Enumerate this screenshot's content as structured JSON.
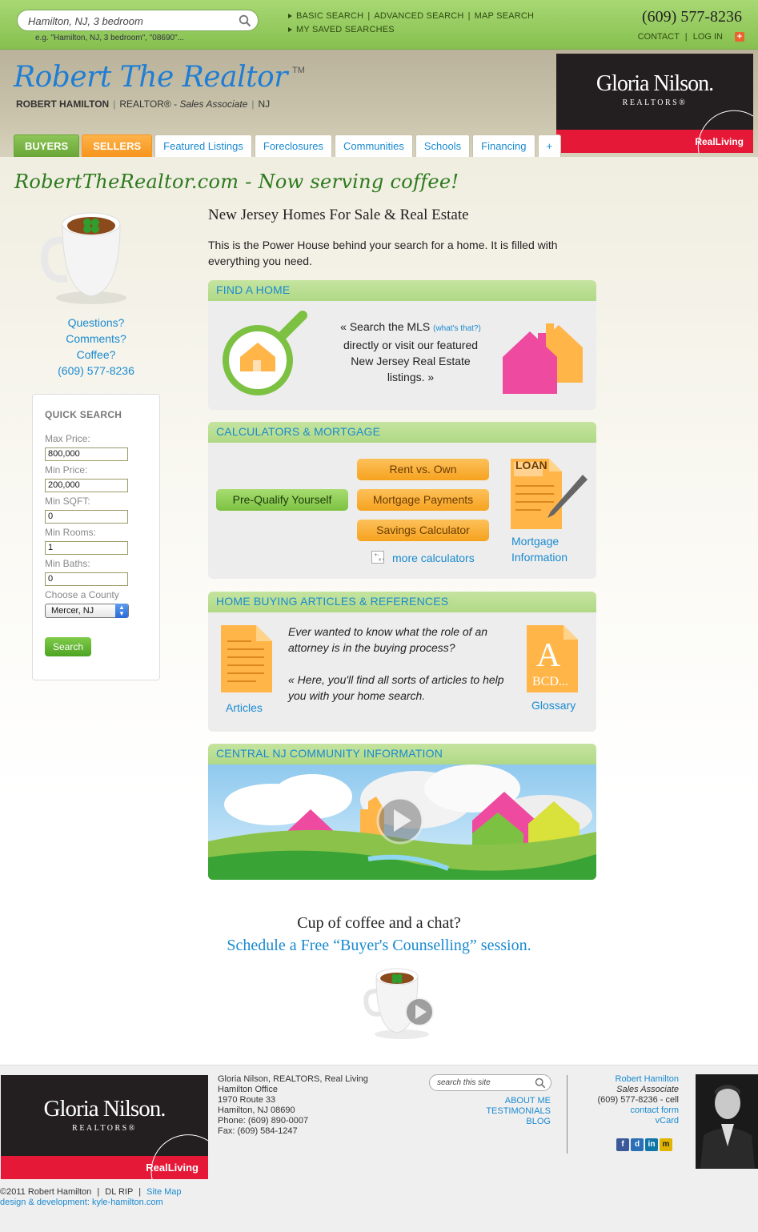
{
  "topbar": {
    "search_value": "Hamilton, NJ, 3 bedroom",
    "search_hint": "e.g. \"Hamilton, NJ, 3 bedroom\", \"08690\"...",
    "nav": [
      "BASIC SEARCH",
      "ADVANCED SEARCH",
      "MAP SEARCH"
    ],
    "saved": "MY SAVED SEARCHES",
    "phone": "(609) 577-8236",
    "contact": "CONTACT",
    "login": "LOG IN",
    "plus": "+"
  },
  "header": {
    "logo": "Robert The Realtor",
    "tm": "TM",
    "agent_name": "ROBERT HAMILTON",
    "agent_title": "REALTOR®",
    "agent_role": "Sales Associate",
    "agent_state": "NJ",
    "brokerage_name": "Gloria Nilson.",
    "brokerage_sub": "REALTORS®",
    "brokerage_tag": "RealLiving"
  },
  "tabs": [
    "BUYERS",
    "SELLERS",
    "Featured Listings",
    "Foreclosures",
    "Communities",
    "Schools",
    "Financing",
    "+"
  ],
  "tagline": "RobertTheRealtor.com - Now serving coffee!",
  "contact": {
    "lines": [
      "Questions?",
      "Comments?",
      "Coffee?",
      "(609) 577-8236"
    ]
  },
  "quick_search": {
    "title": "QUICK SEARCH",
    "fields": [
      {
        "label": "Max Price:",
        "value": "800,000"
      },
      {
        "label": "Min Price:",
        "value": "200,000"
      },
      {
        "label": "Min SQFT:",
        "value": "0"
      },
      {
        "label": "Min Rooms:",
        "value": "1"
      },
      {
        "label": "Min Baths:",
        "value": "0"
      }
    ],
    "county_label": "Choose a County",
    "county_value": "Mercer, NJ",
    "button": "Search"
  },
  "main": {
    "title": "New Jersey Homes For Sale & Real Estate",
    "intro": "This is the Power House behind your search for a home. It is filled with everything you need."
  },
  "find_home": {
    "header": "FIND A HOME",
    "text_a": "« Search the MLS",
    "whats_that": "(what's that?)",
    "text_b": "directly or visit our featured New Jersey Real Estate listings. »"
  },
  "calculators": {
    "header": "CALCULATORS & MORTGAGE",
    "prequalify": "Pre-Qualify Yourself",
    "buttons": [
      "Rent vs. Own",
      "Mortgage Payments",
      "Savings Calculator"
    ],
    "more": "more calculators",
    "loan_label": "LOAN",
    "mortgage_info": [
      "Mortgage",
      "Information"
    ]
  },
  "articles": {
    "header": "HOME BUYING ARTICLES & REFERENCES",
    "q1": "Ever wanted to know what the role of an attorney is in the buying process?",
    "q2": "« Here, you'll find all sorts of articles to help you with your home search.",
    "articles_link": "Articles",
    "glossary_link": "Glossary",
    "glossary_a": "A",
    "glossary_bcd": "BCD..."
  },
  "community": {
    "header": "CENTRAL NJ COMMUNITY INFORMATION"
  },
  "cta": {
    "line1": "Cup of coffee and a chat?",
    "line2": "Schedule a Free “Buyer's Counselling” session."
  },
  "footer": {
    "brokerage_name": "Gloria Nilson.",
    "brokerage_sub": "REALTORS®",
    "brokerage_tag": "RealLiving",
    "address": [
      "Gloria Nilson, REALTORS, Real Living",
      "Hamilton Office",
      "1970 Route 33",
      "Hamilton, NJ 08690",
      "Phone: (609) 890-0007",
      "Fax: (609) 584-1247"
    ],
    "search_placeholder": "search this site",
    "links": [
      "ABOUT ME",
      "TESTIMONIALS",
      "BLOG"
    ],
    "agent_name": "Robert Hamilton",
    "agent_role": "Sales Associate",
    "agent_cell": "(609) 577-8236 - cell",
    "contact_form": "contact form",
    "vcard": "vCard",
    "social": [
      "f",
      "d",
      "in",
      "m"
    ],
    "copyright": "©2011 Robert Hamilton",
    "dl": "DL RIP",
    "sitemap": "Site Map",
    "design": "design & development: kyle-hamilton.com"
  }
}
